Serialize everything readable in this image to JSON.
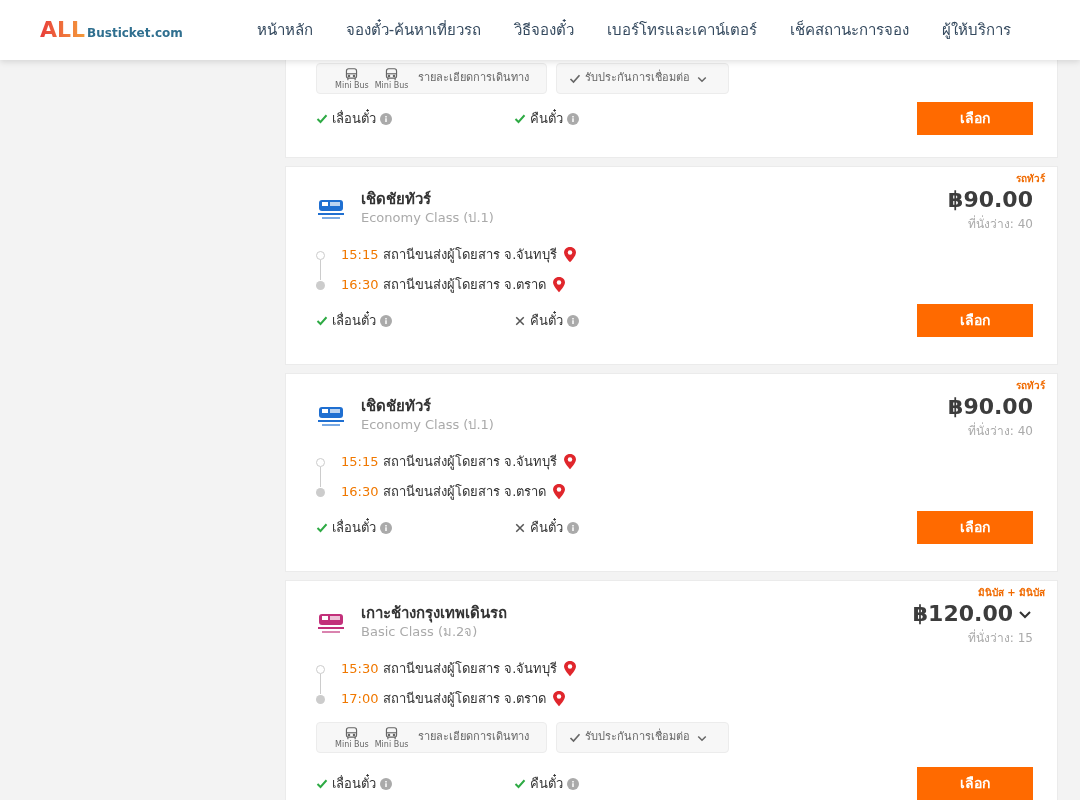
{
  "header": {
    "logo": {
      "brand": "ALL",
      "domain": "Busticket.com"
    },
    "nav": [
      {
        "label": "หน้าหลัก"
      },
      {
        "label": "จองตั๋ว-ค้นหาเที่ยวรถ"
      },
      {
        "label": "วิธีจองตั๋ว"
      },
      {
        "label": "เบอร์โทรและเคาน์เตอร์"
      },
      {
        "label": "เช็คสถานะการจอง"
      },
      {
        "label": "ผู้ให้บริการ"
      }
    ]
  },
  "trips": [
    {
      "route_details": {
        "label": "รายละเอียดการเดินทาง",
        "vehicles": [
          {
            "label": "Mini Bus"
          },
          {
            "label": "Mini Bus"
          }
        ]
      },
      "connection_guarantee": {
        "label": "รับประกันการเชื่อมต่อ"
      },
      "policies": [
        {
          "label": "เลื่อนตั๋ว",
          "allowed": true
        },
        {
          "label": "คืนตั๋ว",
          "allowed": true
        }
      ],
      "button": "เลือก"
    },
    {
      "tag": "รถทัวร์",
      "operator": {
        "name": "เชิดชัยทัวร์",
        "class": "Economy Class (ป.1)",
        "color": "#1f6fd1"
      },
      "price": "฿90.00",
      "expandable": false,
      "seats": "ที่นั่งว่าง: 40",
      "stops": [
        {
          "time": "15:15",
          "station": "สถานีขนส่งผู้โดยสาร จ.จันทบุรี"
        },
        {
          "time": "16:30",
          "station": "สถานีขนส่งผู้โดยสาร จ.ตราด"
        }
      ],
      "policies": [
        {
          "label": "เลื่อนตั๋ว",
          "allowed": true
        },
        {
          "label": "คืนตั๋ว",
          "allowed": false
        }
      ],
      "button": "เลือก"
    },
    {
      "tag": "รถทัวร์",
      "operator": {
        "name": "เชิดชัยทัวร์",
        "class": "Economy Class (ป.1)",
        "color": "#1f6fd1"
      },
      "price": "฿90.00",
      "expandable": false,
      "seats": "ที่นั่งว่าง: 40",
      "stops": [
        {
          "time": "15:15",
          "station": "สถานีขนส่งผู้โดยสาร จ.จันทบุรี"
        },
        {
          "time": "16:30",
          "station": "สถานีขนส่งผู้โดยสาร จ.ตราด"
        }
      ],
      "policies": [
        {
          "label": "เลื่อนตั๋ว",
          "allowed": true
        },
        {
          "label": "คืนตั๋ว",
          "allowed": false
        }
      ],
      "button": "เลือก"
    },
    {
      "tag": "มินิบัส + มินิบัส",
      "operator": {
        "name": "เกาะช้างกรุงเทพเดินรถ",
        "class": "Basic Class (ม.2จ)",
        "color": "#c2307a"
      },
      "price": "฿120.00",
      "expandable": true,
      "seats": "ที่นั่งว่าง: 15",
      "stops": [
        {
          "time": "15:30",
          "station": "สถานีขนส่งผู้โดยสาร จ.จันทบุรี"
        },
        {
          "time": "17:00",
          "station": "สถานีขนส่งผู้โดยสาร จ.ตราด"
        }
      ],
      "route_details": {
        "label": "รายละเอียดการเดินทาง",
        "vehicles": [
          {
            "label": "Mini Bus"
          },
          {
            "label": "Mini Bus"
          }
        ]
      },
      "connection_guarantee": {
        "label": "รับประกันการเชื่อมต่อ"
      },
      "policies": [
        {
          "label": "เลื่อนตั๋ว",
          "allowed": true
        },
        {
          "label": "คืนตั๋ว",
          "allowed": true
        }
      ],
      "button": "เลือก"
    }
  ]
}
